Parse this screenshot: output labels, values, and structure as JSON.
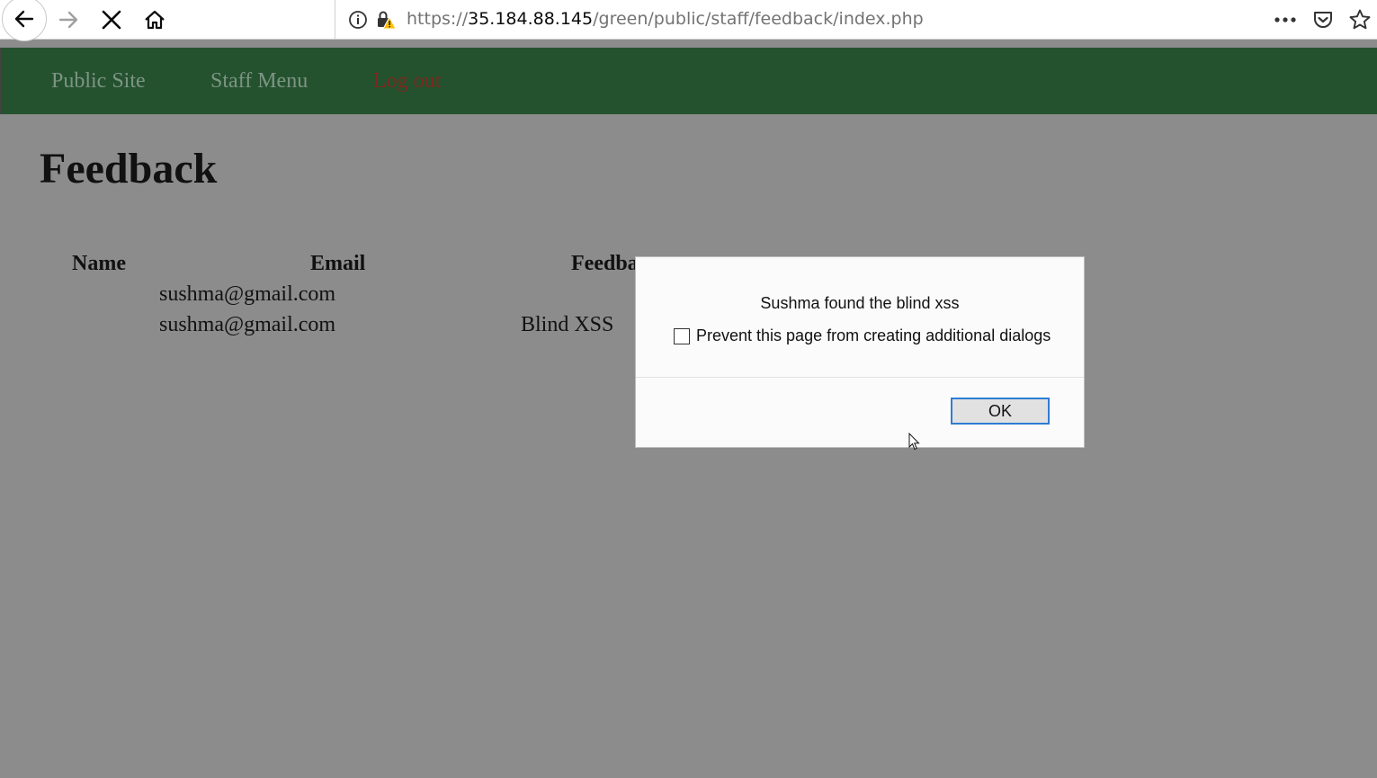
{
  "browser": {
    "url_prefix": "https://",
    "url_host": "35.184.88.145",
    "url_path": "/green/public/staff/feedback/index.php"
  },
  "site_nav": {
    "items": [
      {
        "label": "Public Site"
      },
      {
        "label": "Staff Menu"
      },
      {
        "label": "Log out"
      }
    ]
  },
  "page": {
    "title": "Feedback"
  },
  "table": {
    "headers": [
      "Name",
      "Email",
      "Feedba"
    ],
    "rows": [
      {
        "name": "",
        "email": "sushma@gmail.com",
        "feedback": ""
      },
      {
        "name": "",
        "email": "sushma@gmail.com",
        "feedback": "Blind XSS"
      }
    ]
  },
  "dialog": {
    "message": "Sushma found the blind xss",
    "checkbox_label": "Prevent this page from creating additional dialogs",
    "ok_label": "OK"
  },
  "colors": {
    "nav_bg": "#24522f",
    "page_bg": "#8c8c8c",
    "logout": "#7a2a1e",
    "focus_ring": "#2f7cd4"
  }
}
